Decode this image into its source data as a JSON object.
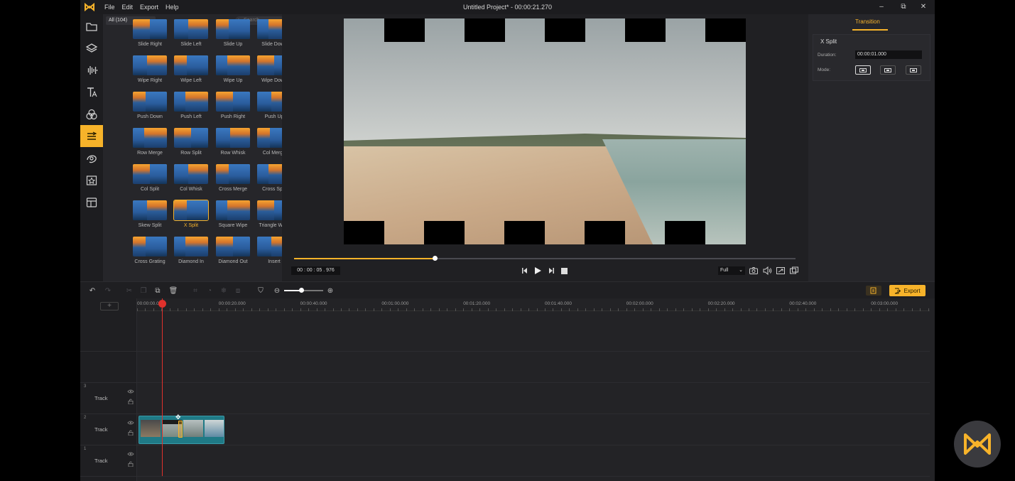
{
  "window": {
    "title": "Untitled Project* - 00:00:21.270",
    "menu": [
      "File",
      "Edit",
      "Export",
      "Help"
    ]
  },
  "sidebar": {
    "items": [
      {
        "icon": "folder-icon"
      },
      {
        "icon": "layers-icon"
      },
      {
        "icon": "audio-wave-icon"
      },
      {
        "icon": "text-icon"
      },
      {
        "icon": "filters-icon"
      },
      {
        "icon": "transitions-icon",
        "active": true
      },
      {
        "icon": "overlay-icon"
      },
      {
        "icon": "elements-icon"
      },
      {
        "icon": "templates-icon"
      }
    ]
  },
  "library": {
    "filter": "All (104)",
    "search_placeholder": "Search",
    "transitions": [
      [
        "Slide Right",
        "Slide Left",
        "Slide Up",
        "Slide Down"
      ],
      [
        "Wipe Right",
        "Wipe Left",
        "Wipe Up",
        "Wipe Down"
      ],
      [
        "Push Down",
        "Push Left",
        "Push Right",
        "Push Up"
      ],
      [
        "Row Merge",
        "Row Split",
        "Row Whisk",
        "Col Merge"
      ],
      [
        "Col Split",
        "Col Whisk",
        "Cross Merge",
        "Cross Split"
      ],
      [
        "Skew Split",
        "X Split",
        "Square Wipe",
        "Triangle Wipe"
      ],
      [
        "Cross Grating",
        "Diamond In",
        "Diamond Out",
        "Insert"
      ]
    ],
    "selected": "X Split"
  },
  "preview": {
    "timecode": "00 : 00 : 05 . 976",
    "progress": 0.28,
    "quality": "Full"
  },
  "properties": {
    "tab": "Transition",
    "name": "X Split",
    "duration_label": "Duration:",
    "duration_value": "00:00:01.000",
    "mode_label": "Mode:",
    "modes": 3,
    "selected_mode": 0
  },
  "toolbar": {
    "export_label": "Export"
  },
  "timeline": {
    "ruler": [
      "00:00:00.000",
      "00:00:20.000",
      "00:00:40.000",
      "00:01:00.000",
      "00:01:20.000",
      "00:01:40.000",
      "00:02:00.000",
      "00:02:20.000",
      "00:02:40.000",
      "00:03:00.000"
    ],
    "tracks": [
      {
        "num": "3",
        "name": "Track"
      },
      {
        "num": "2",
        "name": "Track"
      },
      {
        "num": "1",
        "name": "Track"
      }
    ]
  },
  "colors": {
    "accent": "#f7b32a",
    "playhead": "#e0312c",
    "clip": "#1f7a86"
  }
}
